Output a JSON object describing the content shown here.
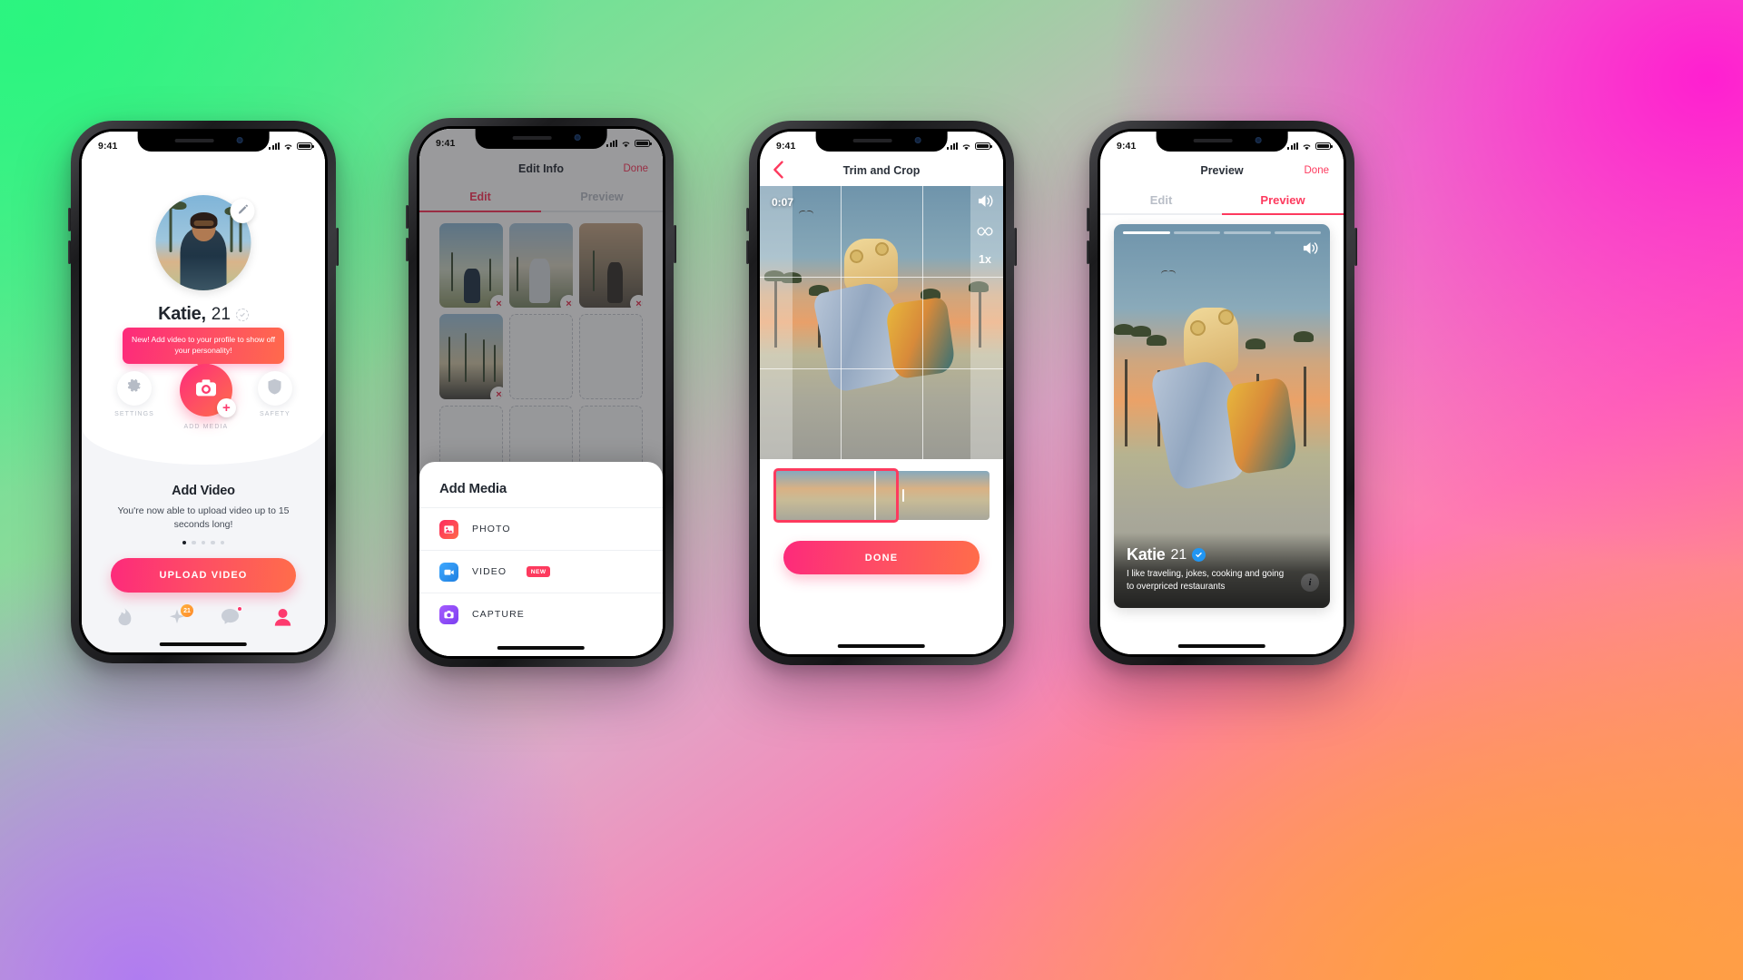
{
  "background": {
    "colors": [
      "#3ef08a",
      "#ff1fd0",
      "#ffa03c",
      "#b07cf0"
    ]
  },
  "accent": {
    "pink": "#fd3a5e",
    "gradient_start": "#fd2a7b",
    "gradient_end": "#ff6d4a",
    "blue_badge": "#2196f3"
  },
  "status_bar": {
    "time": "9:41"
  },
  "phone1": {
    "profile": {
      "name": "Katie,",
      "age": "21",
      "edit_icon": "pencil-icon",
      "verified_icon": "check-circle-dashed-icon"
    },
    "tooltip": "New! Add video to your profile to show off your personality!",
    "actions": [
      {
        "label": "SETTINGS",
        "icon": "gear-icon"
      },
      {
        "label": "ADD MEDIA",
        "icon": "camera-icon",
        "badge": "+"
      },
      {
        "label": "SAFETY",
        "icon": "shield-icon"
      }
    ],
    "card": {
      "title": "Add Video",
      "body": "You're now able to upload video up to 15 seconds long!",
      "dots_total": 5,
      "dot_active": 1
    },
    "upload_button": "UPLOAD VIDEO",
    "tabbar": [
      {
        "icon": "flame-icon",
        "badge": ""
      },
      {
        "icon": "sparkle-icon",
        "badge": "21"
      },
      {
        "icon": "chat-icon",
        "badge": "dot"
      },
      {
        "icon": "profile-icon",
        "badge": ""
      }
    ]
  },
  "phone2": {
    "header": {
      "title": "Edit Info",
      "done": "Done"
    },
    "tabs": [
      {
        "label": "Edit",
        "active": true
      },
      {
        "label": "Preview",
        "active": false
      }
    ],
    "grid": [
      {
        "filled": true
      },
      {
        "filled": true
      },
      {
        "filled": true
      },
      {
        "filled": true
      },
      {
        "filled": false
      },
      {
        "filled": false
      },
      {
        "filled": false
      },
      {
        "filled": false
      },
      {
        "filled": false
      }
    ],
    "sheet": {
      "title": "Add Media",
      "items": [
        {
          "label": "PHOTO",
          "icon": "photo-icon",
          "tag": ""
        },
        {
          "label": "VIDEO",
          "icon": "video-icon",
          "tag": "NEW"
        },
        {
          "label": "CAPTURE",
          "icon": "capture-icon",
          "tag": ""
        }
      ]
    }
  },
  "phone3": {
    "header": {
      "title": "Trim and Crop",
      "back_icon": "chevron-left-icon"
    },
    "video": {
      "timestamp": "0:07",
      "controls": [
        {
          "icon": "speaker-icon",
          "label": ""
        },
        {
          "icon": "loop-infinity-icon",
          "label": ""
        },
        {
          "icon": "speed-icon",
          "label": "1x"
        }
      ]
    },
    "done_button": "DONE"
  },
  "phone4": {
    "header": {
      "title": "Preview",
      "done": "Done"
    },
    "tabs": [
      {
        "label": "Edit",
        "active": false
      },
      {
        "label": "Preview",
        "active": true
      }
    ],
    "card": {
      "name": "Katie",
      "age": "21",
      "verified_icon": "verified-check-icon",
      "bio": "I like traveling, jokes, cooking and going to overpriced restaurants",
      "sound_icon": "speaker-icon",
      "info_icon": "info-icon",
      "progress_total": 4,
      "progress_active": 1
    }
  }
}
